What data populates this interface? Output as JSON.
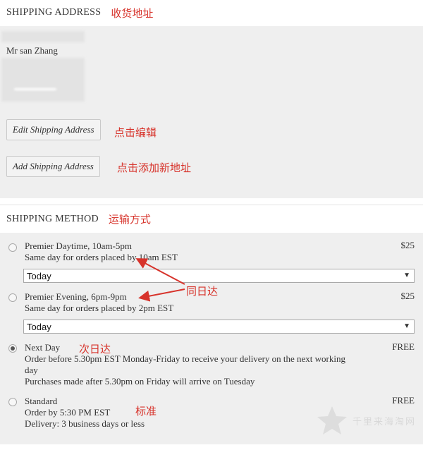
{
  "shipping_address": {
    "title": "SHIPPING ADDRESS",
    "title_annotation": "收货地址",
    "name": "Mr san Zhang",
    "edit_button": "Edit Shipping Address",
    "edit_annotation": "点击编辑",
    "add_button": "Add Shipping Address",
    "add_annotation": "点击添加新地址"
  },
  "shipping_method": {
    "title": "SHIPPING METHOD",
    "title_annotation": "运输方式",
    "options": [
      {
        "name": "Premier Daytime, 10am-5pm",
        "desc": "Same day for orders placed by 10am EST",
        "price": "$25",
        "selected": false,
        "date_select": "Today"
      },
      {
        "name": "Premier Evening, 6pm-9pm",
        "desc": "Same day for orders placed by 2pm EST",
        "price": "$25",
        "selected": false,
        "date_select": "Today"
      },
      {
        "name": "Next Day",
        "desc_line1": "Order before 5.30pm EST Monday-Friday to receive your delivery on the next working",
        "desc_line2": "day",
        "desc_line3": "Purchases made after 5.30pm on Friday will arrive on Tuesday",
        "price": "FREE",
        "selected": true,
        "annotation": "次日达"
      },
      {
        "name": "Standard",
        "desc_line1": "Order by 5:30 PM EST",
        "desc_line2": "Delivery: 3 business days or less",
        "price": "FREE",
        "selected": false,
        "annotation": "标准"
      }
    ],
    "same_day_annotation": "同日达"
  },
  "watermark": {
    "text": "千里来海淘网"
  },
  "colors": {
    "annotation": "#d7332b",
    "panel": "#efefef"
  }
}
